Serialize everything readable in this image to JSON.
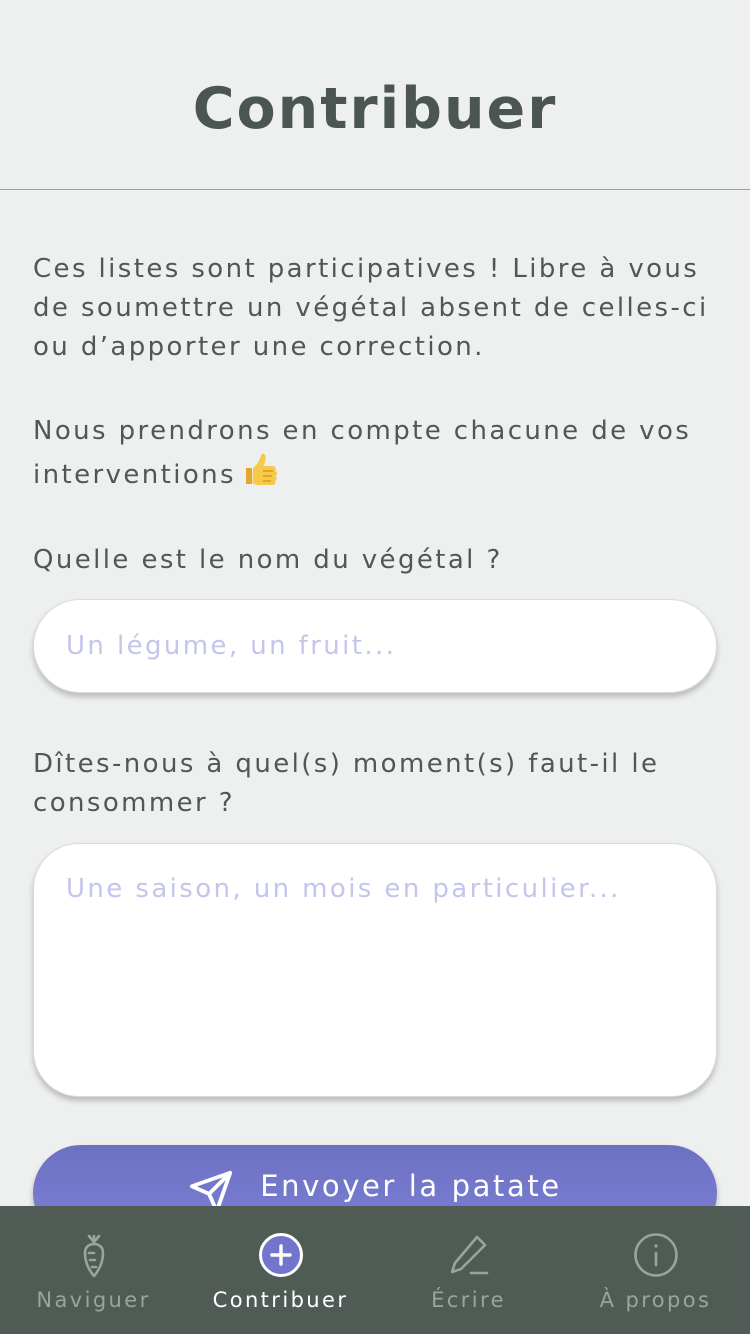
{
  "header": {
    "title": "Contribuer"
  },
  "intro": {
    "paragraph1": "Ces listes sont participatives ! Libre à vous de soumettre un végétal absent de celles-ci ou d’apporter une correction.",
    "paragraph2": "Nous prendrons en compte chacune de vos interventions",
    "paragraph2_emoji": "👍"
  },
  "form": {
    "name_label": "Quelle est le nom du végétal ?",
    "name_placeholder": "Un légume, un fruit...",
    "name_value": "",
    "when_label": "Dîtes-nous à quel(s) moment(s) faut-il le consommer ?",
    "when_placeholder": "Une saison, un mois en particulier...",
    "when_value": "",
    "submit_label": "Envoyer la patate"
  },
  "tabbar": {
    "tabs": [
      {
        "label": "Naviguer",
        "icon": "carrot-icon",
        "active": false
      },
      {
        "label": "Contribuer",
        "icon": "plus-circle-icon",
        "active": true
      },
      {
        "label": "Écrire",
        "icon": "pencil-icon",
        "active": false
      },
      {
        "label": "À propos",
        "icon": "info-circle-icon",
        "active": false
      }
    ]
  },
  "colors": {
    "background": "#eef0f0",
    "text": "#4e5954",
    "accent": "#7176cc",
    "tabbar": "#515b55",
    "tab_inactive": "#9aa39e",
    "placeholder": "#c4c5ec"
  }
}
